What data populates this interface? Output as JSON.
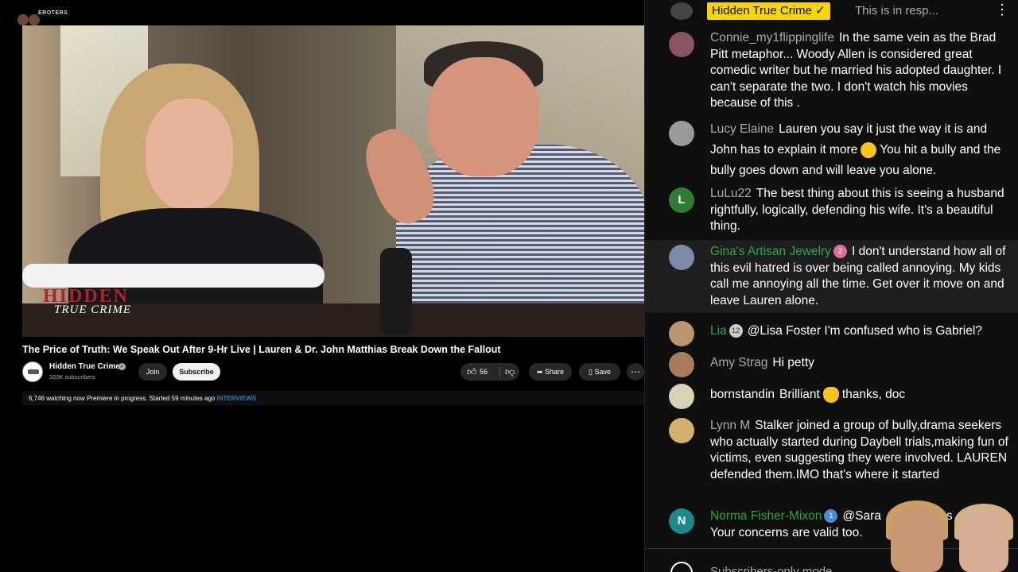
{
  "corner_logo": {
    "text": "EROTERS"
  },
  "video": {
    "watermark_big": "HIDDEN",
    "watermark_small": "TRUE CRIME",
    "title": "The Price of Truth: We Speak Out After 9-Hr Live | Lauren & Dr. John Matthias Break Down the Fallout"
  },
  "channel": {
    "name": "Hidden True Crime",
    "subscribers": "320K subscribers",
    "join_label": "Join",
    "subscribe_label": "Subscribe"
  },
  "actions": {
    "like_count": "56",
    "share_label": "Share",
    "save_label": "Save",
    "more_label": "⋯"
  },
  "description": {
    "watching": "6,746 watching now",
    "status": "Premiere in progress. Started 59 minutes ago",
    "hashtag": "INTERVIEWS"
  },
  "chat": {
    "pinned": {
      "author": "Hidden True Crime ✓",
      "text": "This is in resp..."
    },
    "messages": [
      {
        "author": "Connie_my1flippinglife",
        "text": "In the same vein as the Brad Pitt metaphor... Woody Allen is considered great comedic writer but he married his adopted daughter. I can't separate the two. I don't watch his movies because of this ."
      },
      {
        "author": "Lucy Elaine",
        "text_a": "Lauren you say it just the way it is and John has to explain it more",
        "text_b": "You hit a bully and the bully goes down and will leave you alone."
      },
      {
        "author": "LuLu22",
        "avatar_letter": "L",
        "text": "The best thing about this is seeing a husband rightfully, logically, defending his wife. It's a beautiful thing."
      },
      {
        "author": "Gina's Artisan Jewelry",
        "badge": "2",
        "text": "I don't understand how all of this evil hatred is over being called annoying. My kids call me annoying all the time. Get over it move on and leave Lauren alone."
      },
      {
        "author": "Lia",
        "badge": "12",
        "text": "@Lisa Foster I'm confused who is Gabriel?"
      },
      {
        "author": "Amy Strag",
        "text": "Hi petty"
      },
      {
        "author": "bornstandin",
        "text_a": "Brilliant",
        "text_b": "thanks, doc"
      },
      {
        "author": "Lynn M",
        "text": "Stalker joined a group of bully,drama seekers who actually started during Daybell trials,making fun of victims, even suggesting they were involved. LAUREN defended them.IMO that's where it started"
      },
      {
        "author": "Norma Fisher-Mixon",
        "avatar_letter": "N",
        "badge": "1",
        "text_a": "@Sara",
        "text_b": "nd I'm s",
        "text_c": "Your concerns are valid too."
      }
    ],
    "footer_text": "Subscribers-only mode"
  },
  "colors": {
    "member_green": "#2ba640",
    "pinned_yellow": "#f5d600",
    "link_blue": "#3ea6ff",
    "lulu_avatar": "#2e7d32",
    "norma_avatar": "#1a8a8a"
  }
}
